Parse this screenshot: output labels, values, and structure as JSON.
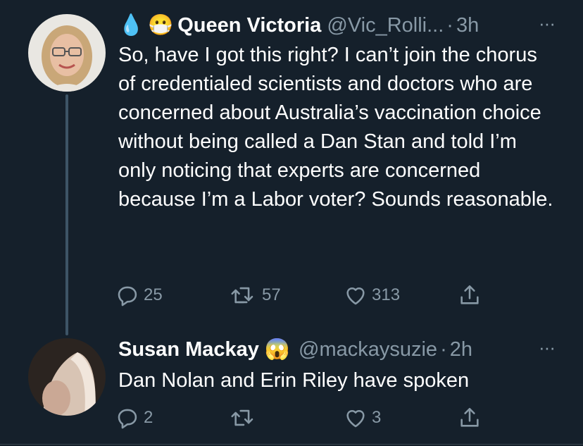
{
  "tweets": [
    {
      "prefix_emojis": [
        "💧",
        "😷"
      ],
      "name": "Queen Victoria",
      "handle": "@Vic_Rolli...",
      "dot": "·",
      "time": "3h",
      "more": "···",
      "text": "So, have I got this right? I can’t join the chorus of credentialed scientists and doctors who are concerned about Australia’s vaccination choice without being called a Dan Stan and told I’m only noticing that experts are concerned because I’m a Labor voter? Sounds reasonable.",
      "replies": "25",
      "retweets": "57",
      "likes": "313"
    },
    {
      "name": "Susan Mackay",
      "name_emoji": "😱",
      "handle": "@mackaysuzie",
      "dot": "·",
      "time": "2h",
      "more": "···",
      "text": "Dan Nolan and Erin Riley have spoken",
      "replies": "2",
      "retweets": "",
      "likes": "3"
    }
  ],
  "icons": {
    "reply": "reply-icon",
    "retweet": "retweet-icon",
    "like": "heart-icon",
    "share": "share-icon"
  },
  "colors": {
    "background": "#15202b",
    "secondary_text": "#8899a6",
    "primary_text": "#ffffff",
    "thread_line": "#3d5466"
  }
}
